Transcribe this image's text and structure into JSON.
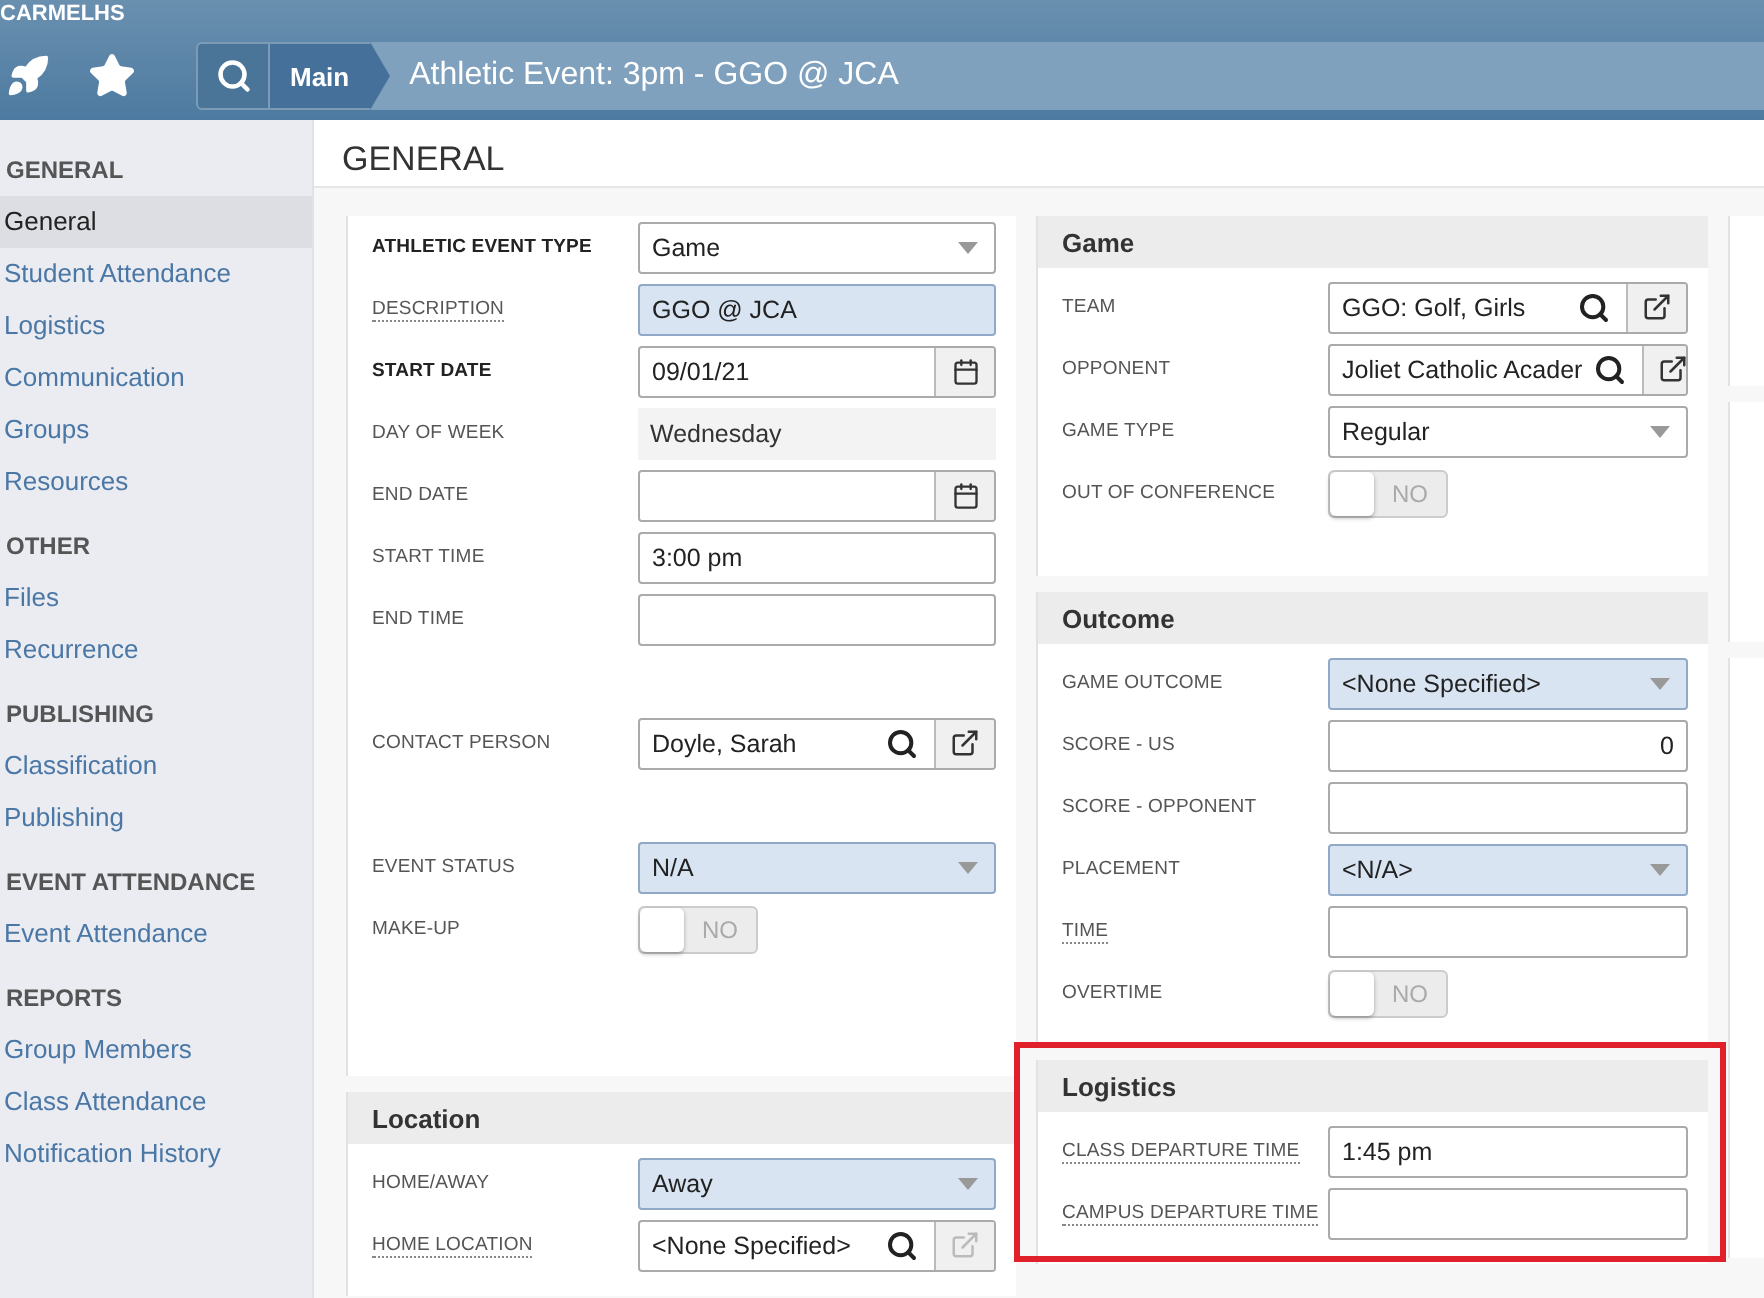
{
  "app": {
    "name": "CARMELHS"
  },
  "breadcrumb": {
    "items": [
      "Main"
    ],
    "title": "Athletic Event: 3pm - GGO @ JCA"
  },
  "sidebar": {
    "groups": [
      {
        "heading": "GENERAL",
        "items": [
          {
            "label": "General",
            "selected": true
          },
          {
            "label": "Student Attendance",
            "selected": false
          },
          {
            "label": "Logistics",
            "selected": false
          },
          {
            "label": "Communication",
            "selected": false
          },
          {
            "label": "Groups",
            "selected": false
          },
          {
            "label": "Resources",
            "selected": false
          }
        ]
      },
      {
        "heading": "OTHER",
        "items": [
          {
            "label": "Files",
            "selected": false
          },
          {
            "label": "Recurrence",
            "selected": false
          }
        ]
      },
      {
        "heading": "PUBLISHING",
        "items": [
          {
            "label": "Classification",
            "selected": false
          },
          {
            "label": "Publishing",
            "selected": false
          }
        ]
      },
      {
        "heading": "EVENT ATTENDANCE",
        "items": [
          {
            "label": "Event Attendance",
            "selected": false
          }
        ]
      },
      {
        "heading": "REPORTS",
        "items": [
          {
            "label": "Group Members",
            "selected": false
          },
          {
            "label": "Class Attendance",
            "selected": false
          },
          {
            "label": "Notification History",
            "selected": false
          }
        ]
      }
    ]
  },
  "page": {
    "title": "GENERAL"
  },
  "columns": [
    {
      "cards": [
        {
          "sections": [
            {
              "rows": [
                {
                  "label": "ATHLETIC EVENT TYPE",
                  "required": true,
                  "help": false,
                  "kind": "select",
                  "value": "Game",
                  "highlighted": false
                },
                {
                  "label": "DESCRIPTION",
                  "required": false,
                  "help": true,
                  "kind": "text",
                  "value": "GGO @ JCA",
                  "highlighted": true
                },
                {
                  "label": "START DATE",
                  "required": true,
                  "help": false,
                  "kind": "date",
                  "value": "09/01/21",
                  "highlighted": false
                },
                {
                  "label": "DAY OF WEEK",
                  "required": false,
                  "help": false,
                  "kind": "readonly",
                  "value": "Wednesday"
                },
                {
                  "label": "END DATE",
                  "required": false,
                  "help": false,
                  "kind": "date",
                  "highlighted": false
                },
                {
                  "label": "START TIME",
                  "required": false,
                  "help": false,
                  "kind": "text",
                  "value": "3:00 pm",
                  "highlighted": false
                },
                {
                  "label": "END TIME",
                  "required": false,
                  "help": false,
                  "kind": "text",
                  "highlighted": false
                }
              ]
            },
            {
              "rows": [
                {
                  "label": "CONTACT PERSON",
                  "required": false,
                  "help": false,
                  "kind": "lookup",
                  "value": "Doyle, Sarah",
                  "highlighted": false,
                  "link_disabled": false
                }
              ]
            },
            {
              "rows": [
                {
                  "label": "EVENT STATUS",
                  "required": false,
                  "help": false,
                  "kind": "select",
                  "value": "N/A",
                  "highlighted": true
                },
                {
                  "label": "MAKE-UP",
                  "required": false,
                  "help": false,
                  "kind": "toggle",
                  "value": "NO",
                  "on": false
                }
              ]
            }
          ]
        },
        {
          "sections": [
            {
              "title": "Location",
              "highlighted": false,
              "rows": [
                {
                  "label": "HOME/AWAY",
                  "required": false,
                  "help": false,
                  "kind": "select",
                  "value": "Away",
                  "highlighted": true
                },
                {
                  "label": "HOME LOCATION",
                  "required": false,
                  "help": true,
                  "kind": "lookup",
                  "value": "<None Specified>",
                  "highlighted": false,
                  "link_disabled": true
                }
              ]
            }
          ]
        }
      ]
    },
    {
      "cards": [
        {
          "sections": [
            {
              "title": "Game",
              "highlighted": false,
              "rows": [
                {
                  "label": "TEAM",
                  "required": false,
                  "help": false,
                  "kind": "lookup",
                  "value": "GGO: Golf, Girls",
                  "highlighted": false,
                  "link_disabled": false
                },
                {
                  "label": "OPPONENT",
                  "required": false,
                  "help": false,
                  "kind": "lookup",
                  "value": "Joliet Catholic Acader",
                  "highlighted": false,
                  "link_disabled": false
                },
                {
                  "label": "GAME TYPE",
                  "required": false,
                  "help": false,
                  "kind": "select",
                  "value": "Regular",
                  "highlighted": false
                },
                {
                  "label": "OUT OF CONFERENCE",
                  "required": false,
                  "help": false,
                  "kind": "toggle",
                  "value": "NO",
                  "on": false
                }
              ]
            }
          ]
        },
        {
          "sections": [
            {
              "title": "Outcome",
              "highlighted": false,
              "rows": [
                {
                  "label": "GAME OUTCOME",
                  "required": false,
                  "help": false,
                  "kind": "select",
                  "value": "<None Specified>",
                  "highlighted": true
                },
                {
                  "label": "SCORE - US",
                  "required": false,
                  "help": false,
                  "kind": "number",
                  "value": "0",
                  "highlighted": false
                },
                {
                  "label": "SCORE - OPPONENT",
                  "required": false,
                  "help": false,
                  "kind": "number",
                  "highlighted": false
                },
                {
                  "label": "PLACEMENT",
                  "required": false,
                  "help": false,
                  "kind": "select",
                  "value": "<N/A>",
                  "highlighted": true
                },
                {
                  "label": "TIME",
                  "required": false,
                  "help": true,
                  "kind": "text",
                  "highlighted": false
                },
                {
                  "label": "OVERTIME",
                  "required": false,
                  "help": false,
                  "kind": "toggle",
                  "value": "NO",
                  "on": false
                }
              ]
            }
          ]
        },
        {
          "sections": [
            {
              "title": "Logistics",
              "highlighted": true,
              "rows": [
                {
                  "label": "CLASS DEPARTURE TIME",
                  "required": false,
                  "help": true,
                  "kind": "text",
                  "value": "1:45 pm",
                  "highlighted": false
                },
                {
                  "label": "CAMPUS DEPARTURE TIME",
                  "required": false,
                  "help": true,
                  "kind": "text",
                  "highlighted": false
                }
              ]
            }
          ]
        }
      ]
    }
  ]
}
